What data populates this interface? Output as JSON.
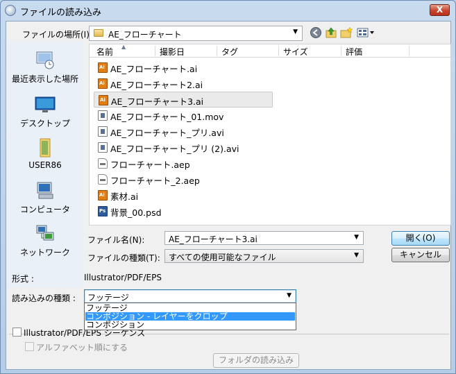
{
  "window": {
    "title": "ファイルの読み込み",
    "close_label": "X"
  },
  "look_in": {
    "label": "ファイルの場所(I):",
    "value": "AE_フローチャート"
  },
  "toolbar": {
    "icons": [
      "back-icon",
      "up-folder-icon",
      "new-folder-icon",
      "views-menu-icon"
    ]
  },
  "places": [
    {
      "label": "最近表示した場所",
      "icon": "recent-places-icon"
    },
    {
      "label": "デスクトップ",
      "icon": "desktop-icon"
    },
    {
      "label": "USER86",
      "icon": "user-folder-icon"
    },
    {
      "label": "コンピュータ",
      "icon": "computer-icon"
    },
    {
      "label": "ネットワーク",
      "icon": "network-icon"
    }
  ],
  "columns": [
    "名前",
    "撮影日",
    "タグ",
    "サイズ",
    "評価"
  ],
  "files": [
    {
      "name": "AE_フローチャート.ai",
      "type": "ai"
    },
    {
      "name": "AE_フローチャート2.ai",
      "type": "ai"
    },
    {
      "name": "AE_フローチャート3.ai",
      "type": "ai",
      "selected": true
    },
    {
      "name": "AE_フローチャート_01.mov",
      "type": "mov"
    },
    {
      "name": "AE_フローチャート_プリ.avi",
      "type": "avi"
    },
    {
      "name": "AE_フローチャート_プリ (2).avi",
      "type": "avi"
    },
    {
      "name": "フローチャート.aep",
      "type": "aep"
    },
    {
      "name": "フローチャート_2.aep",
      "type": "aep"
    },
    {
      "name": "素材.ai",
      "type": "ai"
    },
    {
      "name": "背景_00.psd",
      "type": "psd"
    }
  ],
  "filename": {
    "label": "ファイル名(N):",
    "value": "AE_フローチャート3.ai"
  },
  "filetype": {
    "label": "ファイルの種類(T):",
    "value": "すべての使用可能なファイル"
  },
  "buttons": {
    "open": "開く(O)",
    "cancel": "キャンセル",
    "import_folder": "フォルダの読み込み"
  },
  "format": {
    "label": "形式 :",
    "value": "Illustrator/PDF/EPS"
  },
  "import_as": {
    "label": "読み込みの種類 :",
    "value": "フッテージ",
    "options": [
      "フッテージ",
      "コンポジション - レイヤーをクロップ",
      "コンポジション"
    ],
    "highlighted_index": 1
  },
  "sequence": {
    "label": "Illustrator/PDF/EPS シーケンス",
    "checked": false
  },
  "alphabetical": {
    "label": "アルファベット順にする",
    "checked": false,
    "disabled": true
  },
  "colors": {
    "highlight": "#3399ff",
    "title_bar": "#c8daee"
  }
}
